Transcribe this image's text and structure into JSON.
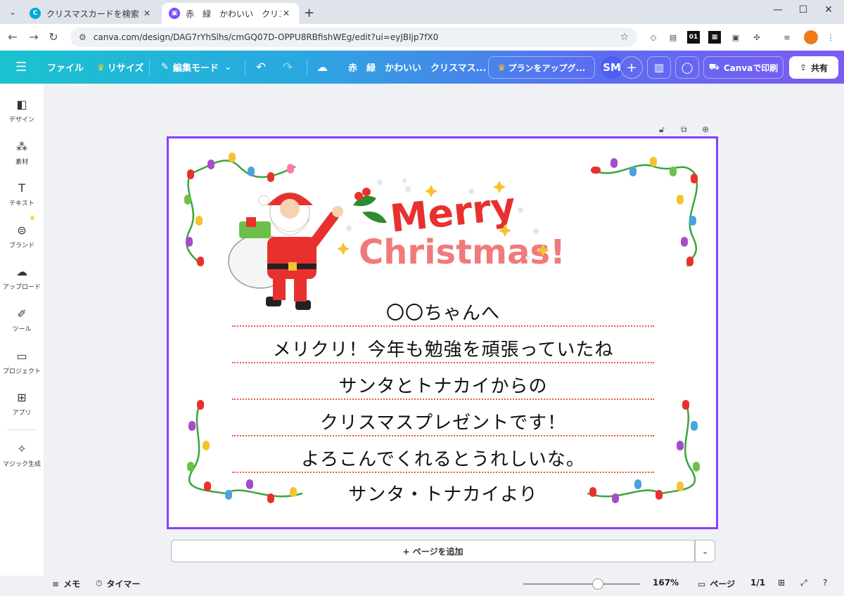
{
  "browser": {
    "tabs": [
      {
        "title": "クリスマスカードを検索 - Canva",
        "active": false,
        "favicon_color": "#00a8d8"
      },
      {
        "title": "赤　緑　かわいい　クリスマスカード",
        "active": true,
        "favicon_color": "#7c4dff"
      }
    ],
    "url": "canva.com/design/DAG7rYhSlhs/cmGQ07D-OPPU8RBfishWEg/edit?ui=eyJBIjp7fX0",
    "ext_01": "01"
  },
  "header": {
    "file": "ファイル",
    "resize": "リサイズ",
    "edit_mode": "編集モード",
    "doc_title": "赤　緑　かわいい　クリスマス...",
    "upgrade": "プランをアップグ...",
    "avatar": "SM",
    "print": "Canvaで印刷",
    "share": "共有"
  },
  "sidebar": {
    "items": [
      {
        "label": "デザイン",
        "icon": "design-icon"
      },
      {
        "label": "素材",
        "icon": "elements-icon"
      },
      {
        "label": "テキスト",
        "icon": "text-icon"
      },
      {
        "label": "ブランド",
        "icon": "brand-icon"
      },
      {
        "label": "アップロード",
        "icon": "upload-icon"
      },
      {
        "label": "ツール",
        "icon": "tools-icon"
      },
      {
        "label": "プロジェクト",
        "icon": "projects-icon"
      },
      {
        "label": "アプリ",
        "icon": "apps-icon"
      },
      {
        "label": "マジック生成",
        "icon": "magic-icon"
      }
    ]
  },
  "card": {
    "lines": [
      "〇〇ちゃんへ",
      "メリクリ！今年も勉強を頑張っていたね",
      "サンタとトナカイからの",
      "クリスマスプレゼントです！",
      "よろこんでくれるとうれしいな。",
      "サンタ・トナカイより"
    ],
    "greeting_1": "Merry",
    "greeting_2": "Christmas!",
    "colors": {
      "title_red": "#e8312f",
      "title_pink": "#f07a7a",
      "dots": "#e8584a",
      "border": "#8b3dff"
    }
  },
  "add_page": "+ ページを追加",
  "bottom": {
    "notes": "メモ",
    "timer": "タイマー",
    "zoom": "167%",
    "pages_label": "ページ",
    "page_count": "1/1",
    "zoom_fraction": 0.64
  }
}
